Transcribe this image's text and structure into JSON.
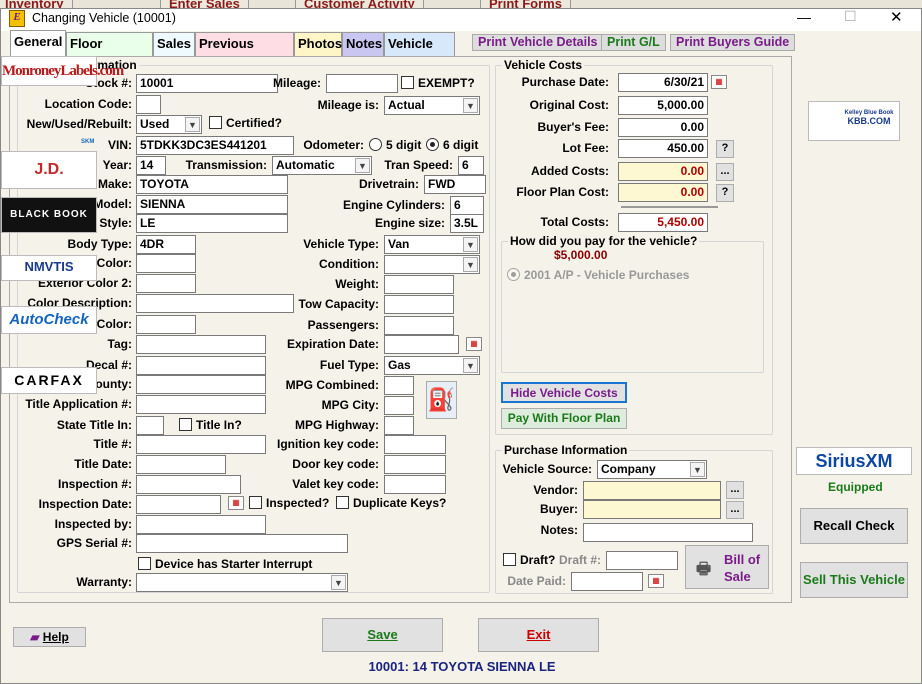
{
  "window": {
    "title": "Changing Vehicle  (10001)",
    "minimize": "—",
    "maximize": "☐",
    "close": "✕"
  },
  "background_tabs": [
    "Inventory",
    "Enter Sales",
    "Customer Activity",
    "Print Forms"
  ],
  "tabs": [
    {
      "label": "General",
      "color": "#ffffff"
    },
    {
      "label": "Floor Planning",
      "color": "#eaffea"
    },
    {
      "label": "Sales",
      "color": "#eefaff"
    },
    {
      "label": "Previous Owner",
      "color": "#ffdde4"
    },
    {
      "label": "Photos",
      "color": "#fff6c8"
    },
    {
      "label": "Notes",
      "color": "#c9c6f2"
    },
    {
      "label": "Vehicle Bill",
      "color": "#d7e8fb"
    }
  ],
  "print_buttons": [
    {
      "label": "Print Vehicle Details",
      "color": "#7a1b8a"
    },
    {
      "label": "Print G/L",
      "color": "#1a7a1a"
    },
    {
      "label": "Print Buyers Guide",
      "color": "#7a1b8a"
    }
  ],
  "vehicle_info": {
    "title": "Vehicle Information",
    "stock": {
      "label": "Stock #:",
      "value": "10001"
    },
    "mileage": {
      "label": "Mileage:",
      "value": ""
    },
    "exempt": {
      "label": "EXEMPT?",
      "checked": false
    },
    "location": {
      "label": "Location Code:",
      "value": ""
    },
    "mileage_is": {
      "label": "Mileage is:",
      "value": "Actual"
    },
    "nur": {
      "label": "New/Used/Rebuilt:",
      "value": "Used"
    },
    "certified": {
      "label": "Certified?",
      "checked": false
    },
    "vin": {
      "label": "VIN:",
      "value": "5TDKK3DC3ES441201",
      "icon_text": "SKM"
    },
    "odometer": {
      "label": "Odometer:",
      "opt1": "5 digit",
      "opt2": "6 digit",
      "selected": "6 digit"
    },
    "year": {
      "label": "Year:",
      "value": "14"
    },
    "transmission": {
      "label": "Transmission:",
      "value": "Automatic"
    },
    "tran_speed": {
      "label": "Tran Speed:",
      "value": "6"
    },
    "make": {
      "label": "Make:",
      "value": "TOYOTA"
    },
    "drivetrain": {
      "label": "Drivetrain:",
      "value": "FWD"
    },
    "model": {
      "label": "Model:",
      "value": "SIENNA"
    },
    "cylinders": {
      "label": "Engine Cylinders:",
      "value": "6"
    },
    "style": {
      "label": "Style:",
      "value": "LE"
    },
    "engine_size": {
      "label": "Engine size:",
      "value": "3.5L"
    },
    "body_type": {
      "label": "Body Type:",
      "value": "4DR"
    },
    "vehicle_type": {
      "label": "Vehicle Type:",
      "value": "Van"
    },
    "ext_color": {
      "label": "Exterior Color:",
      "value": ""
    },
    "condition": {
      "label": "Condition:",
      "value": ""
    },
    "ext_color2": {
      "label": "Exterior Color 2:",
      "value": ""
    },
    "weight": {
      "label": "Weight:",
      "value": ""
    },
    "color_desc": {
      "label": "Color Description:",
      "value": ""
    },
    "tow": {
      "label": "Tow Capacity:",
      "value": ""
    },
    "int_color": {
      "label": "Interior Color:",
      "value": ""
    },
    "passengers": {
      "label": "Passengers:",
      "value": ""
    },
    "tag": {
      "label": "Tag:",
      "value": ""
    },
    "exp_date": {
      "label": "Expiration Date:",
      "value": ""
    },
    "decal": {
      "label": "Decal #:",
      "value": ""
    },
    "fuel": {
      "label": "Fuel Type:",
      "value": "Gas"
    },
    "county": {
      "label": "County:",
      "value": ""
    },
    "mpg_comb": {
      "label": "MPG Combined:",
      "value": ""
    },
    "title_app": {
      "label": "Title Application #:",
      "value": ""
    },
    "mpg_city": {
      "label": "MPG City:",
      "value": ""
    },
    "state_title": {
      "label": "State Title In:",
      "value": ""
    },
    "title_in": {
      "label": "Title In?",
      "checked": false
    },
    "mpg_hwy": {
      "label": "MPG Highway:",
      "value": ""
    },
    "title_no": {
      "label": "Title #:",
      "value": ""
    },
    "ign_key": {
      "label": "Ignition key code:",
      "value": ""
    },
    "title_date": {
      "label": "Title Date:",
      "value": ""
    },
    "door_key": {
      "label": "Door key code:",
      "value": ""
    },
    "insp_no": {
      "label": "Inspection #:",
      "value": ""
    },
    "valet_key": {
      "label": "Valet key code:",
      "value": ""
    },
    "insp_date": {
      "label": "Inspection Date:",
      "value": ""
    },
    "inspected": {
      "label": "Inspected?",
      "checked": false
    },
    "dup_keys": {
      "label": "Duplicate Keys?",
      "checked": false
    },
    "insp_by": {
      "label": "Inspected by:",
      "value": ""
    },
    "gps": {
      "label": "GPS Serial #:",
      "value": ""
    },
    "starter": {
      "label": "Device has Starter Interrupt",
      "checked": false
    },
    "warranty": {
      "label": "Warranty:",
      "value": ""
    }
  },
  "costs": {
    "title": "Vehicle Costs",
    "purchase_date": {
      "label": "Purchase Date:",
      "value": "6/30/21"
    },
    "original": {
      "label": "Original Cost:",
      "value": "5,000.00"
    },
    "buyer_fee": {
      "label": "Buyer's Fee:",
      "value": "0.00"
    },
    "lot_fee": {
      "label": "Lot Fee:",
      "value": "450.00"
    },
    "added": {
      "label": "Added Costs:",
      "value": "0.00"
    },
    "floor_plan": {
      "label": "Floor Plan Cost:",
      "value": "0.00"
    },
    "total": {
      "label": "Total Costs:",
      "value": "5,450.00"
    },
    "q": "?",
    "more": "...",
    "payment": {
      "title": "How did you pay for the vehicle?",
      "amount": "$5,000.00",
      "option": "2001  A/P - Vehicle Purchases"
    },
    "hide_btn": "Hide Vehicle Costs",
    "floor_btn": "Pay With Floor Plan"
  },
  "purchase": {
    "title": "Purchase Information",
    "source": {
      "label": "Vehicle Source:",
      "value": "Company"
    },
    "vendor": {
      "label": "Vendor:",
      "value": ""
    },
    "buyer": {
      "label": "Buyer:",
      "value": ""
    },
    "notes": {
      "label": "Notes:",
      "value": ""
    },
    "draft": {
      "label": "Draft?",
      "checked": false
    },
    "draft_no": {
      "label": "Draft #:",
      "value": ""
    },
    "date_paid": {
      "label": "Date Paid:",
      "value": ""
    },
    "bill_of_sale": "Bill of Sale"
  },
  "sidebar": {
    "monroney": "MonroneyLabels.com",
    "kbb": "KBB.COM",
    "kbb_small": "Kelley Blue Book",
    "jdpower": "J.D. POWER",
    "blackbook": "BLACK BOOK",
    "nmvtis": "NMVTIS",
    "autocheck": "AutoCheck",
    "carfax": "CARFAX",
    "sirius": "SiriusXM",
    "equipped": "Equipped",
    "recall": "Recall Check",
    "sell": "Sell This Vehicle"
  },
  "footer": {
    "help": "Help",
    "save": "Save",
    "exit": "Exit",
    "status": "10001:  14 TOYOTA SIENNA LE"
  },
  "colors": {
    "accent_purple": "#7a1b8a",
    "green": "#1a7a1a",
    "red": "#b00000",
    "navy": "#1a237e"
  }
}
